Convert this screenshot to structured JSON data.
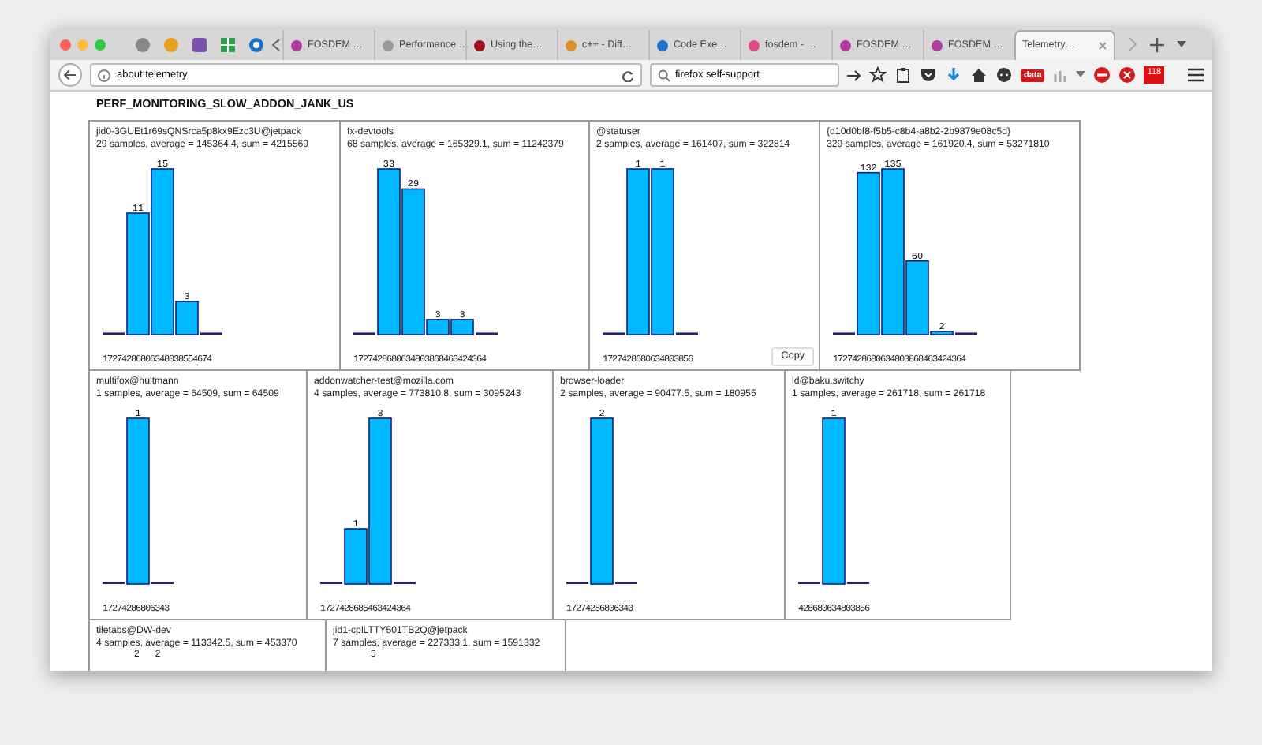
{
  "browser": {
    "tabs": [
      {
        "label": "FOSDEM …",
        "selected": false
      },
      {
        "label": "Performance …",
        "selected": false
      },
      {
        "label": "Using the…",
        "selected": false
      },
      {
        "label": "c++ - Diff…",
        "selected": false
      },
      {
        "label": "Code Exe…",
        "selected": false
      },
      {
        "label": "fosdem - …",
        "selected": false
      },
      {
        "label": "FOSDEM …",
        "selected": false
      },
      {
        "label": "FOSDEM …",
        "selected": false
      },
      {
        "label": "Telemetry…",
        "selected": true
      }
    ],
    "url": "about:telemetry",
    "search": {
      "value": "firefox self-support"
    },
    "data_badge": "data",
    "notification_count": "118"
  },
  "page": {
    "heading": "PERF_MONITORING_SLOW_ADDON_JANK_US",
    "histograms": [
      {
        "name": "jid0-3GUEt1r69sQNSrca5p8kx9Ezc3U@jetpack",
        "summary": "29 samples, average = 145364.4, sum = 4215569",
        "bars": [
          {
            "kind": "empty"
          },
          {
            "kind": "count",
            "label": "11"
          },
          {
            "kind": "count",
            "label": "15"
          },
          {
            "kind": "count",
            "label": "3"
          },
          {
            "kind": "empty"
          }
        ],
        "axis_labels": "17274286806348038554674"
      },
      {
        "name": "fx-devtools",
        "summary": "68 samples, average = 165329.1, sum = 11242379",
        "bars": [
          {
            "kind": "empty"
          },
          {
            "kind": "count",
            "label": "33"
          },
          {
            "kind": "count",
            "label": "29"
          },
          {
            "kind": "count",
            "label": "3"
          },
          {
            "kind": "count",
            "label": "3"
          },
          {
            "kind": "empty"
          }
        ],
        "axis_labels": "1727428680634803868463424364"
      },
      {
        "name": "@statuser",
        "summary": "2 samples, average = 161407, sum = 322814",
        "bars": [
          {
            "kind": "empty"
          },
          {
            "kind": "count",
            "label": "1"
          },
          {
            "kind": "count",
            "label": "1"
          },
          {
            "kind": "empty"
          }
        ],
        "axis_labels": "1727428680634803856",
        "copy_button": "Copy"
      },
      {
        "name": "{d10d0bf8-f5b5-c8b4-a8b2-2b9879e08c5d}",
        "summary": "329 samples, average = 161920.4, sum = 53271810",
        "bars": [
          {
            "kind": "empty"
          },
          {
            "kind": "count",
            "label": "132"
          },
          {
            "kind": "count",
            "label": "135"
          },
          {
            "kind": "count",
            "label": "60"
          },
          {
            "kind": "count",
            "label": "2"
          },
          {
            "kind": "empty"
          }
        ],
        "axis_labels": "1727428680634803868463424364"
      },
      {
        "name": "multifox@hultmann",
        "summary": "1 samples, average = 64509, sum = 64509",
        "bars": [
          {
            "kind": "empty"
          },
          {
            "kind": "count",
            "label": "1"
          },
          {
            "kind": "empty"
          }
        ],
        "axis_labels": "17274286806343"
      },
      {
        "name": "addonwatcher-test@mozilla.com",
        "summary": "4 samples, average = 773810.8, sum = 3095243",
        "bars": [
          {
            "kind": "empty"
          },
          {
            "kind": "count",
            "label": "1"
          },
          {
            "kind": "count",
            "label": "3"
          },
          {
            "kind": "empty"
          }
        ],
        "axis_labels": "1727428685463424364"
      },
      {
        "name": "browser-loader",
        "summary": "2 samples, average = 90477.5, sum = 180955",
        "bars": [
          {
            "kind": "empty"
          },
          {
            "kind": "count",
            "label": "2"
          },
          {
            "kind": "empty"
          }
        ],
        "axis_labels": "17274286806343"
      },
      {
        "name": "ld@baku.switchy",
        "summary": "1 samples, average = 261718, sum = 261718",
        "bars": [
          {
            "kind": "empty"
          },
          {
            "kind": "count",
            "label": "1"
          },
          {
            "kind": "empty"
          }
        ],
        "axis_labels": "428680634803856"
      },
      {
        "name": "tiletabs@DW-dev",
        "summary": "4 samples, average = 113342.5, sum = 453370",
        "bar_labels": [
          "2",
          "2"
        ]
      },
      {
        "name": "jid1-cplLTTY501TB2Q@jetpack",
        "summary": "7 samples, average = 227333.1, sum = 1591332",
        "bar_labels": [
          "5"
        ]
      }
    ]
  }
}
